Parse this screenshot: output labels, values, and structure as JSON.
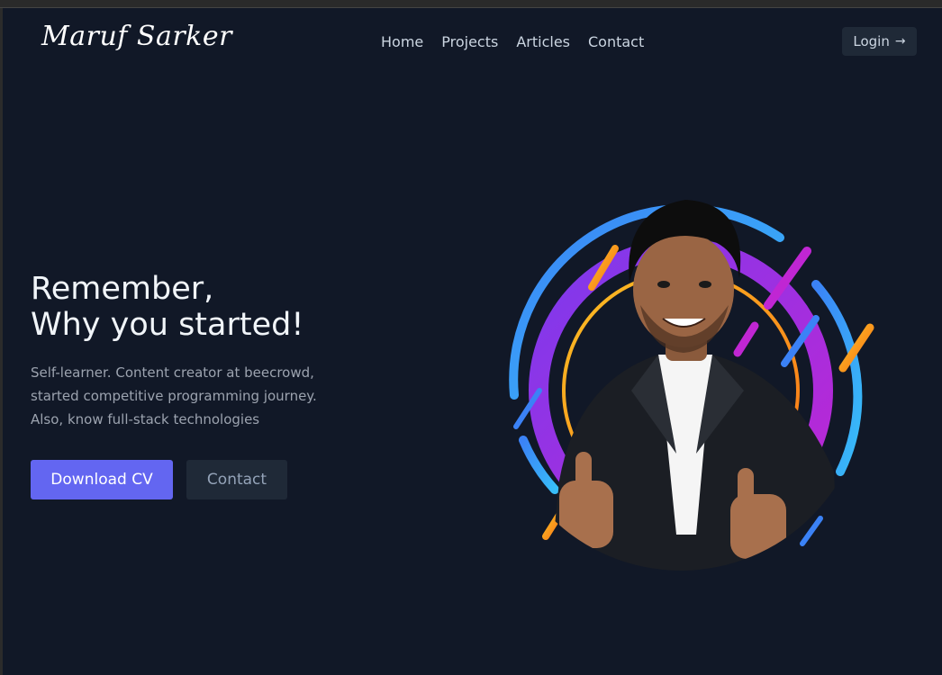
{
  "header": {
    "logo": "Maruf Sarker",
    "nav": [
      "Home",
      "Projects",
      "Articles",
      "Contact"
    ],
    "login_label": "Login",
    "login_icon": "arrow-right-icon"
  },
  "hero": {
    "title_line1": "Remember,",
    "title_line2": "Why you started!",
    "desc_line1": "Self-learner. Content creator at beecrowd,",
    "desc_line2": "started competitive programming journey.",
    "desc_line3": "Also, know full-stack technologies",
    "primary_button": "Download CV",
    "secondary_button": "Contact",
    "image": "profile-photo-with-colorful-ring"
  },
  "colors": {
    "background": "#111827",
    "accent": "#6366f1",
    "button_secondary": "#1f2937",
    "text_primary": "#f1f5f9",
    "text_muted": "#9ca3af"
  }
}
